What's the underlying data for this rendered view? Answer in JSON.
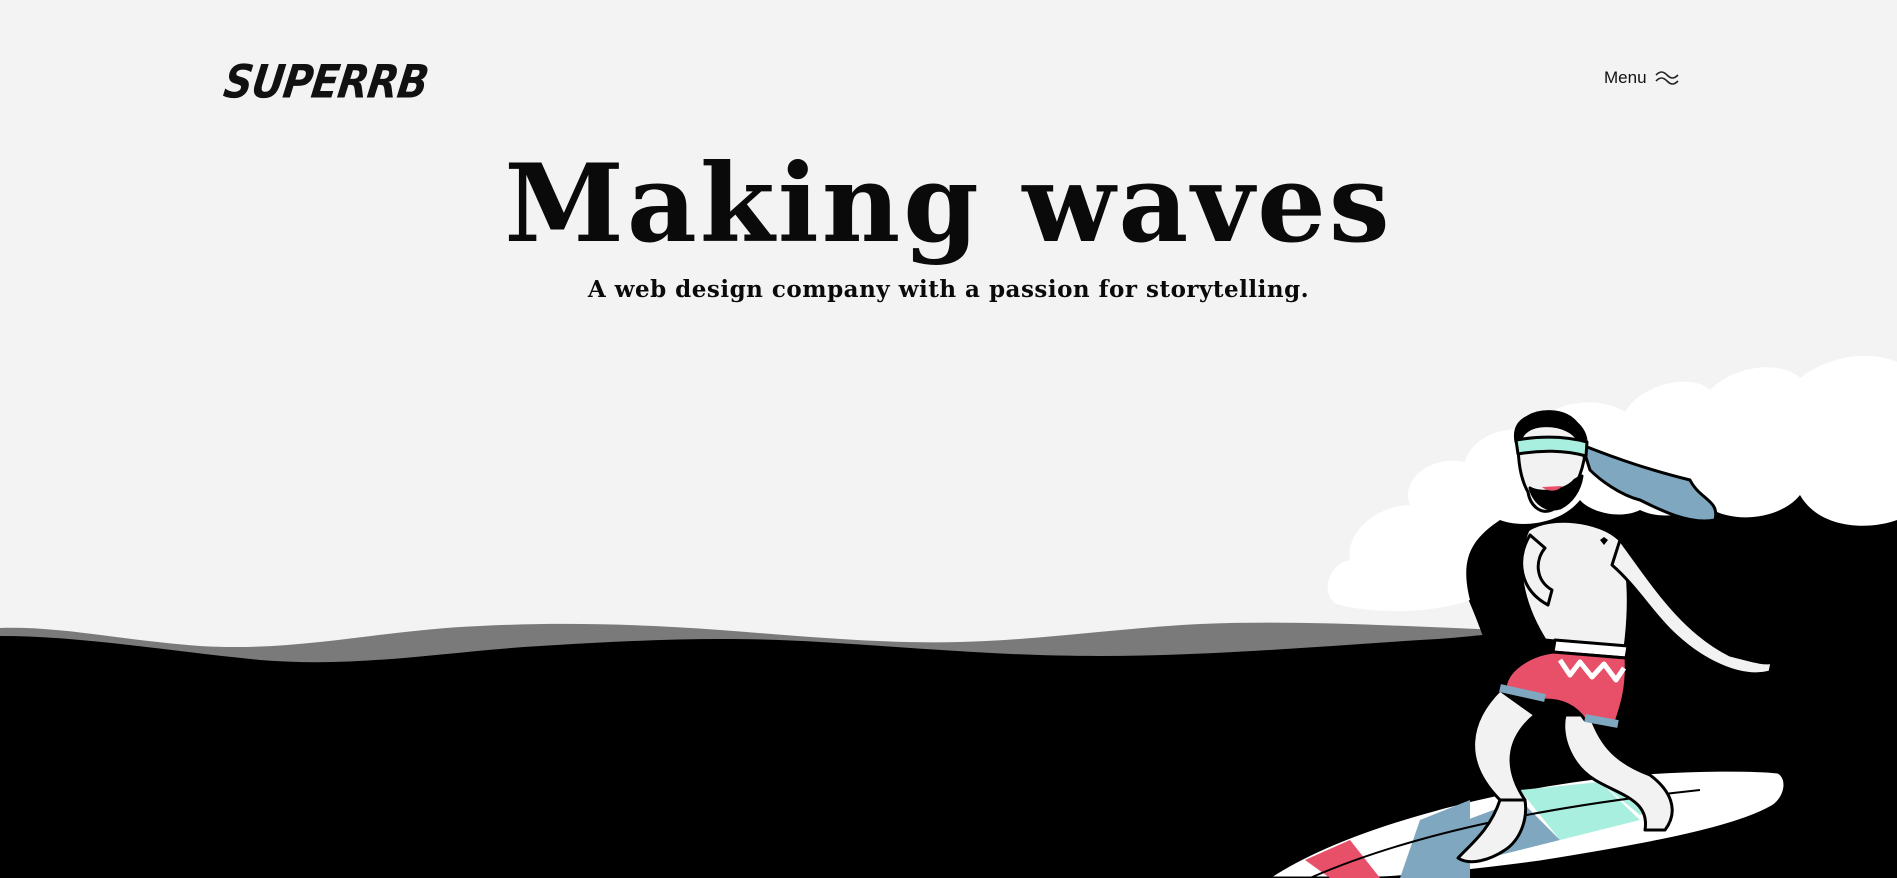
{
  "header": {
    "logo_text": "SUPERRB",
    "menu_label": "Menu"
  },
  "hero": {
    "title": "Making waves",
    "subtitle": "A web design company with a passion for storytelling."
  },
  "colors": {
    "background": "#f3f3f3",
    "ocean": "#000000",
    "distant_wave": "#7a7a7a",
    "foam": "#ffffff",
    "shorts_red": "#e8506a",
    "mint": "#a8efe0",
    "steel_blue": "#7fa7bf"
  },
  "icons": {
    "menu": "wave-menu-icon"
  }
}
